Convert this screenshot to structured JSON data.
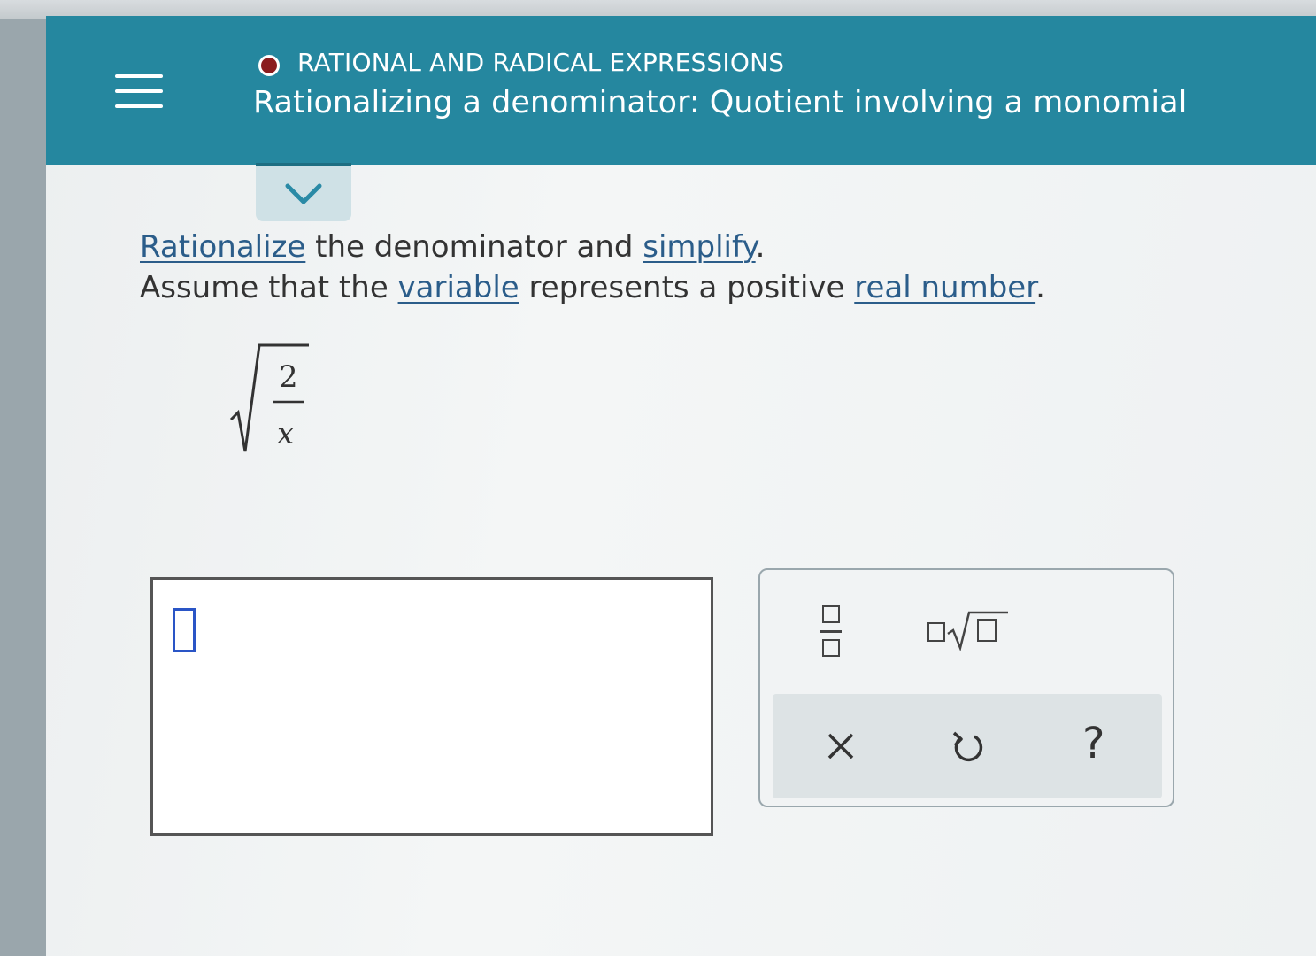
{
  "header": {
    "topic": "RATIONAL AND RADICAL EXPRESSIONS",
    "title": "Rationalizing a denominator: Quotient involving a monomial",
    "menu_icon": "hamburger-menu-icon",
    "status_dot_color": "#8b1d1f",
    "background_color": "#25879f"
  },
  "collapse": {
    "icon": "chevron-down-icon"
  },
  "question": {
    "line1": {
      "link1": "Rationalize",
      "text1": " the denominator and ",
      "link2": "simplify",
      "text2": "."
    },
    "line2": {
      "text1": "Assume that the ",
      "link1": "variable",
      "text2": " represents a positive ",
      "link2": "real number",
      "text3": "."
    }
  },
  "expression": {
    "numerator": "2",
    "denominator": "x"
  },
  "keypad": {
    "keys": [
      "fraction-key",
      "nth-root-key"
    ],
    "actions": {
      "clear_icon": "close-icon",
      "undo_icon": "undo-icon",
      "help_label": "?"
    }
  }
}
